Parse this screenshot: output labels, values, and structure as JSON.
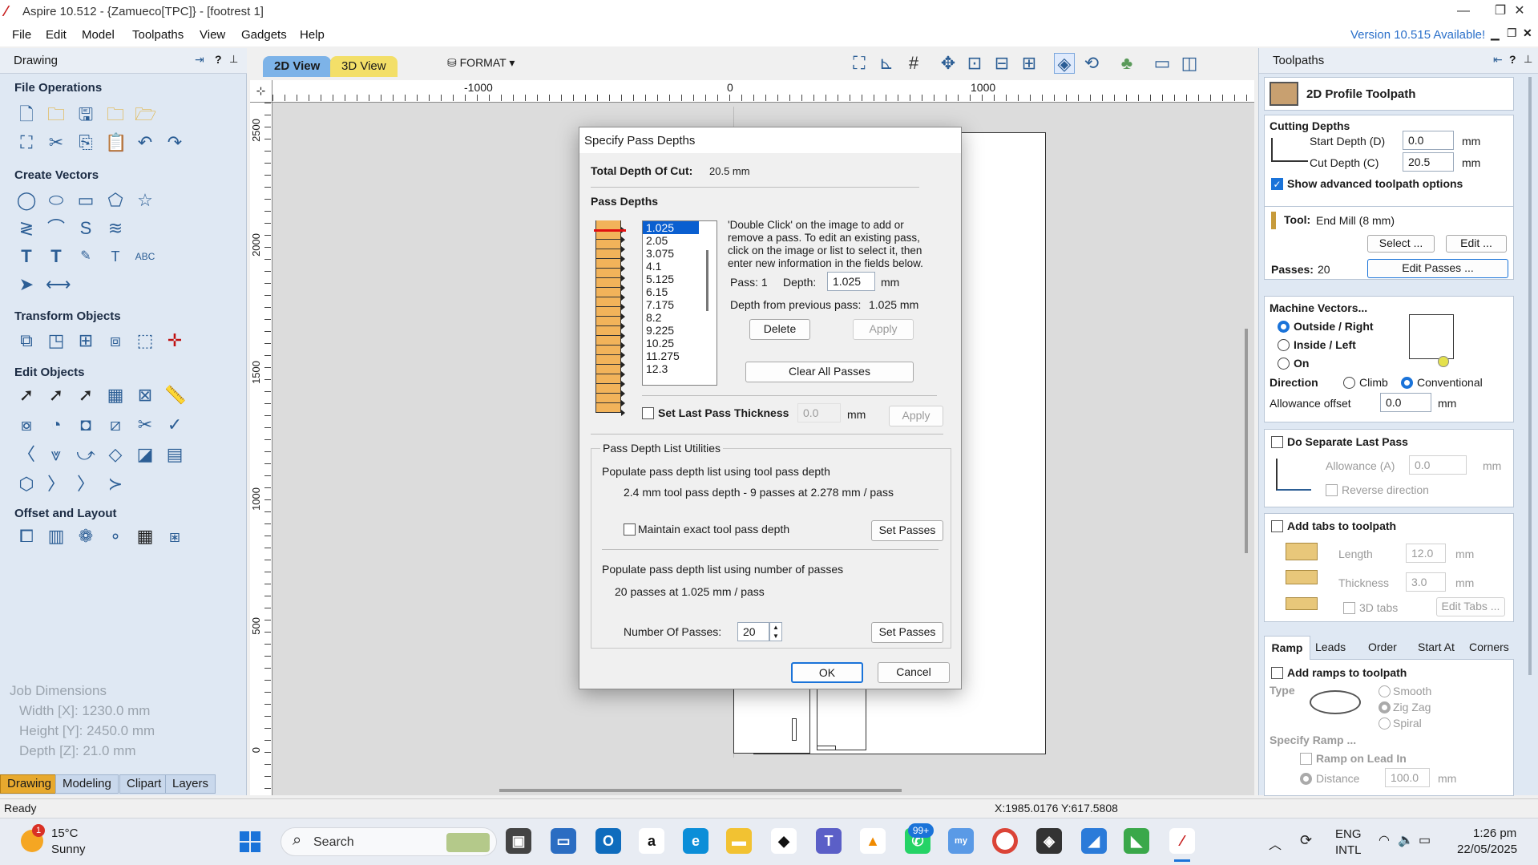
{
  "window": {
    "title": "Aspire 10.512 - {Zamueco[TPC]} - [footrest 1]"
  },
  "menu": {
    "items": [
      "File",
      "Edit",
      "Model",
      "Toolpaths",
      "View",
      "Gadgets",
      "Help"
    ],
    "update": "Version 10.515 Available!"
  },
  "left_panel": {
    "title": "Drawing",
    "sections": {
      "file_ops": "File Operations",
      "create_vectors": "Create Vectors",
      "transform": "Transform Objects",
      "edit_objects": "Edit Objects",
      "offset_layout": "Offset and Layout"
    },
    "job": {
      "title": "Job Dimensions",
      "width": "Width  [X]: 1230.0 mm",
      "height": "Height [Y]: 2450.0 mm",
      "depth": "Depth  [Z]: 21.0 mm"
    },
    "tabs": [
      "Drawing",
      "Modeling",
      "Clipart",
      "Layers"
    ]
  },
  "view": {
    "tab2d": "2D View",
    "tab3d": "3D View",
    "format": "FORMAT"
  },
  "ruler": {
    "top": [
      "-1000",
      "0",
      "1000"
    ],
    "left": [
      "2500",
      "2000",
      "1500",
      "1000",
      "500",
      "0"
    ]
  },
  "dialog": {
    "title": "Specify Pass Depths",
    "total_label": "Total Depth Of Cut:",
    "total_value": "20.5 mm",
    "pass_depths_label": "Pass Depths",
    "passes": [
      "1.025",
      "2.05",
      "3.075",
      "4.1",
      "5.125",
      "6.15",
      "7.175",
      "8.2",
      "9.225",
      "10.25",
      "11.275",
      "12.3"
    ],
    "help": "'Double Click' on the image to add or remove a pass. To edit an existing pass, click on the image or list to select it, then enter new information in the fields below.",
    "pass_label": "Pass: 1",
    "depth_label": "Depth:",
    "depth_value": "1.025",
    "mm": "mm",
    "from_prev": "Depth from previous pass:",
    "from_prev_value": "1.025 mm",
    "delete": "Delete",
    "apply": "Apply",
    "clear_all": "Clear All Passes",
    "set_last": "Set Last Pass Thickness",
    "set_last_value": "0.0",
    "utilities_title": "Pass Depth List Utilities",
    "pop_tool": "Populate pass depth list using tool pass depth",
    "tool_info": "2.4 mm tool pass depth - 9 passes at 2.278 mm / pass",
    "maintain": "Maintain exact tool pass depth",
    "set_passes": "Set Passes",
    "pop_num": "Populate pass depth list using number of passes",
    "num_info": "20 passes at 1.025 mm / pass",
    "num_label": "Number Of Passes:",
    "num_value": "20",
    "ok": "OK",
    "cancel": "Cancel"
  },
  "right_panel": {
    "title": "Toolpaths",
    "toolpath_name": "2D Profile Toolpath",
    "cutting_depths": "Cutting Depths",
    "start_depth_label": "Start Depth (D)",
    "start_depth": "0.0",
    "cut_depth_label": "Cut Depth (C)",
    "cut_depth": "20.5",
    "mm": "mm",
    "show_advanced": "Show advanced toolpath options",
    "tool_label": "Tool:",
    "tool_name": "End Mill (8 mm)",
    "select": "Select ...",
    "edit": "Edit ...",
    "passes_label": "Passes:",
    "passes_value": "20",
    "edit_passes": "Edit Passes ...",
    "machine_vectors": "Machine Vectors...",
    "outside": "Outside / Right",
    "inside": "Inside / Left",
    "on": "On",
    "direction": "Direction",
    "climb": "Climb",
    "conventional": "Conventional",
    "allowance_offset": "Allowance offset",
    "allowance_value": "0.0",
    "separate_last": "Do Separate Last Pass",
    "allowance_a": "Allowance (A)",
    "allowance_a_value": "0.0",
    "reverse": "Reverse direction",
    "add_tabs": "Add tabs to toolpath",
    "length": "Length",
    "length_value": "12.0",
    "thickness": "Thickness",
    "thickness_value": "3.0",
    "tabs3d": "3D tabs",
    "edit_tabs": "Edit Tabs ...",
    "bottom_tabs": [
      "Ramp",
      "Leads",
      "Order",
      "Start At",
      "Corners"
    ],
    "add_ramps": "Add ramps to toolpath",
    "type": "Type",
    "smooth": "Smooth",
    "zigzag": "Zig Zag",
    "spiral": "Spiral",
    "specify_ramp": "Specify Ramp ...",
    "ramp_lead_in": "Ramp on Lead In",
    "distance": "Distance",
    "distance_value": "100.0"
  },
  "status": {
    "left": "Ready",
    "coords": "X:1985.0176 Y:617.5808"
  },
  "taskbar": {
    "temp": "15°C",
    "weather": "Sunny",
    "search": "Search",
    "lang1": "ENG",
    "lang2": "INTL",
    "time": "1:26 pm",
    "date": "22/05/2025",
    "badge": "99+",
    "weather_badge": "1"
  }
}
